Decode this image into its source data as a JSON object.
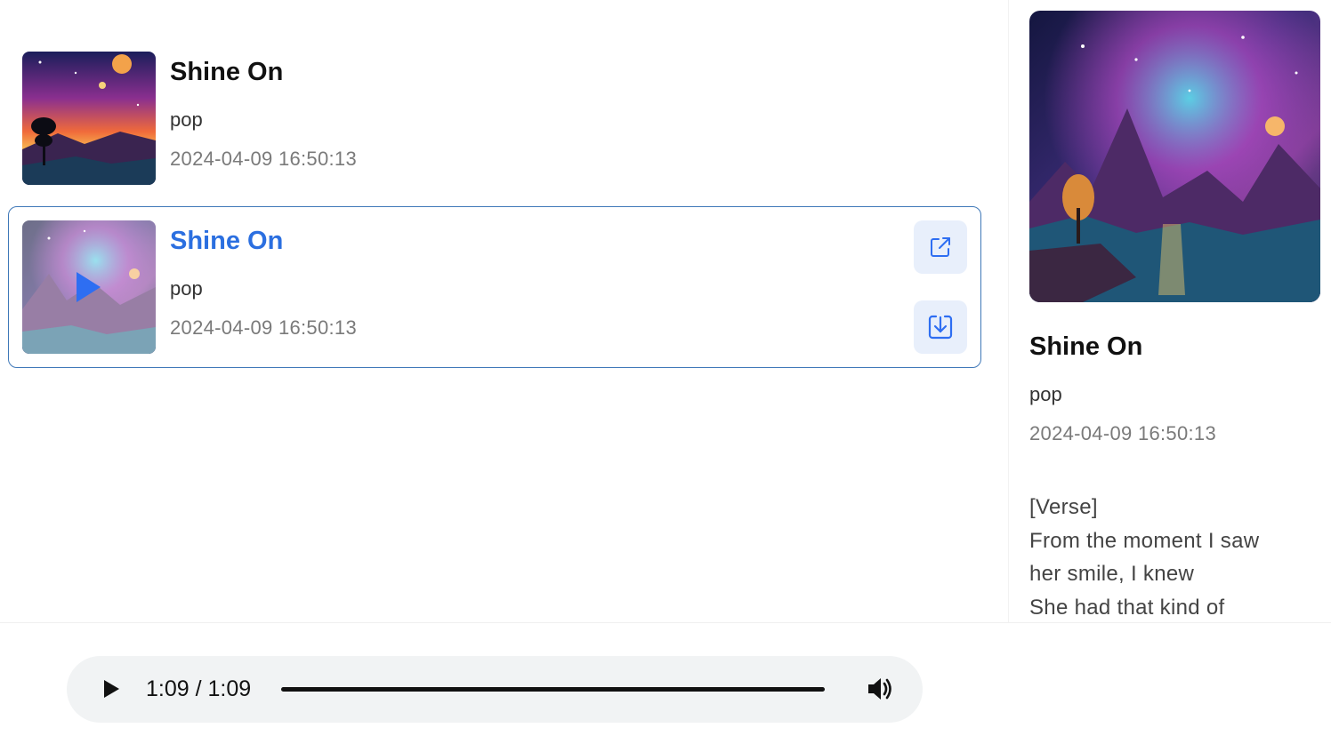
{
  "songs": [
    {
      "title": "Shine On",
      "genre": "pop",
      "created": "2024-04-09 16:50:13",
      "active": false
    },
    {
      "title": "Shine On",
      "genre": "pop",
      "created": "2024-04-09 16:50:13",
      "active": true
    }
  ],
  "actions": {
    "share_icon": "external-link-icon",
    "download_icon": "download-icon"
  },
  "detail": {
    "title": "Shine On",
    "genre": "pop",
    "created": "2024-04-09 16:50:13",
    "lyrics": [
      "[Verse]",
      "From the moment I saw",
      "her smile, I knew",
      "She had that kind of"
    ]
  },
  "player": {
    "time": "1:09 / 1:09",
    "progress_fraction": 1.0,
    "play_icon": "play-icon",
    "volume_icon": "volume-icon"
  },
  "colors": {
    "accent": "#2b6fe0",
    "active_border": "#3f78b8",
    "action_bg": "#e8effb",
    "player_bg": "#f1f3f4"
  }
}
